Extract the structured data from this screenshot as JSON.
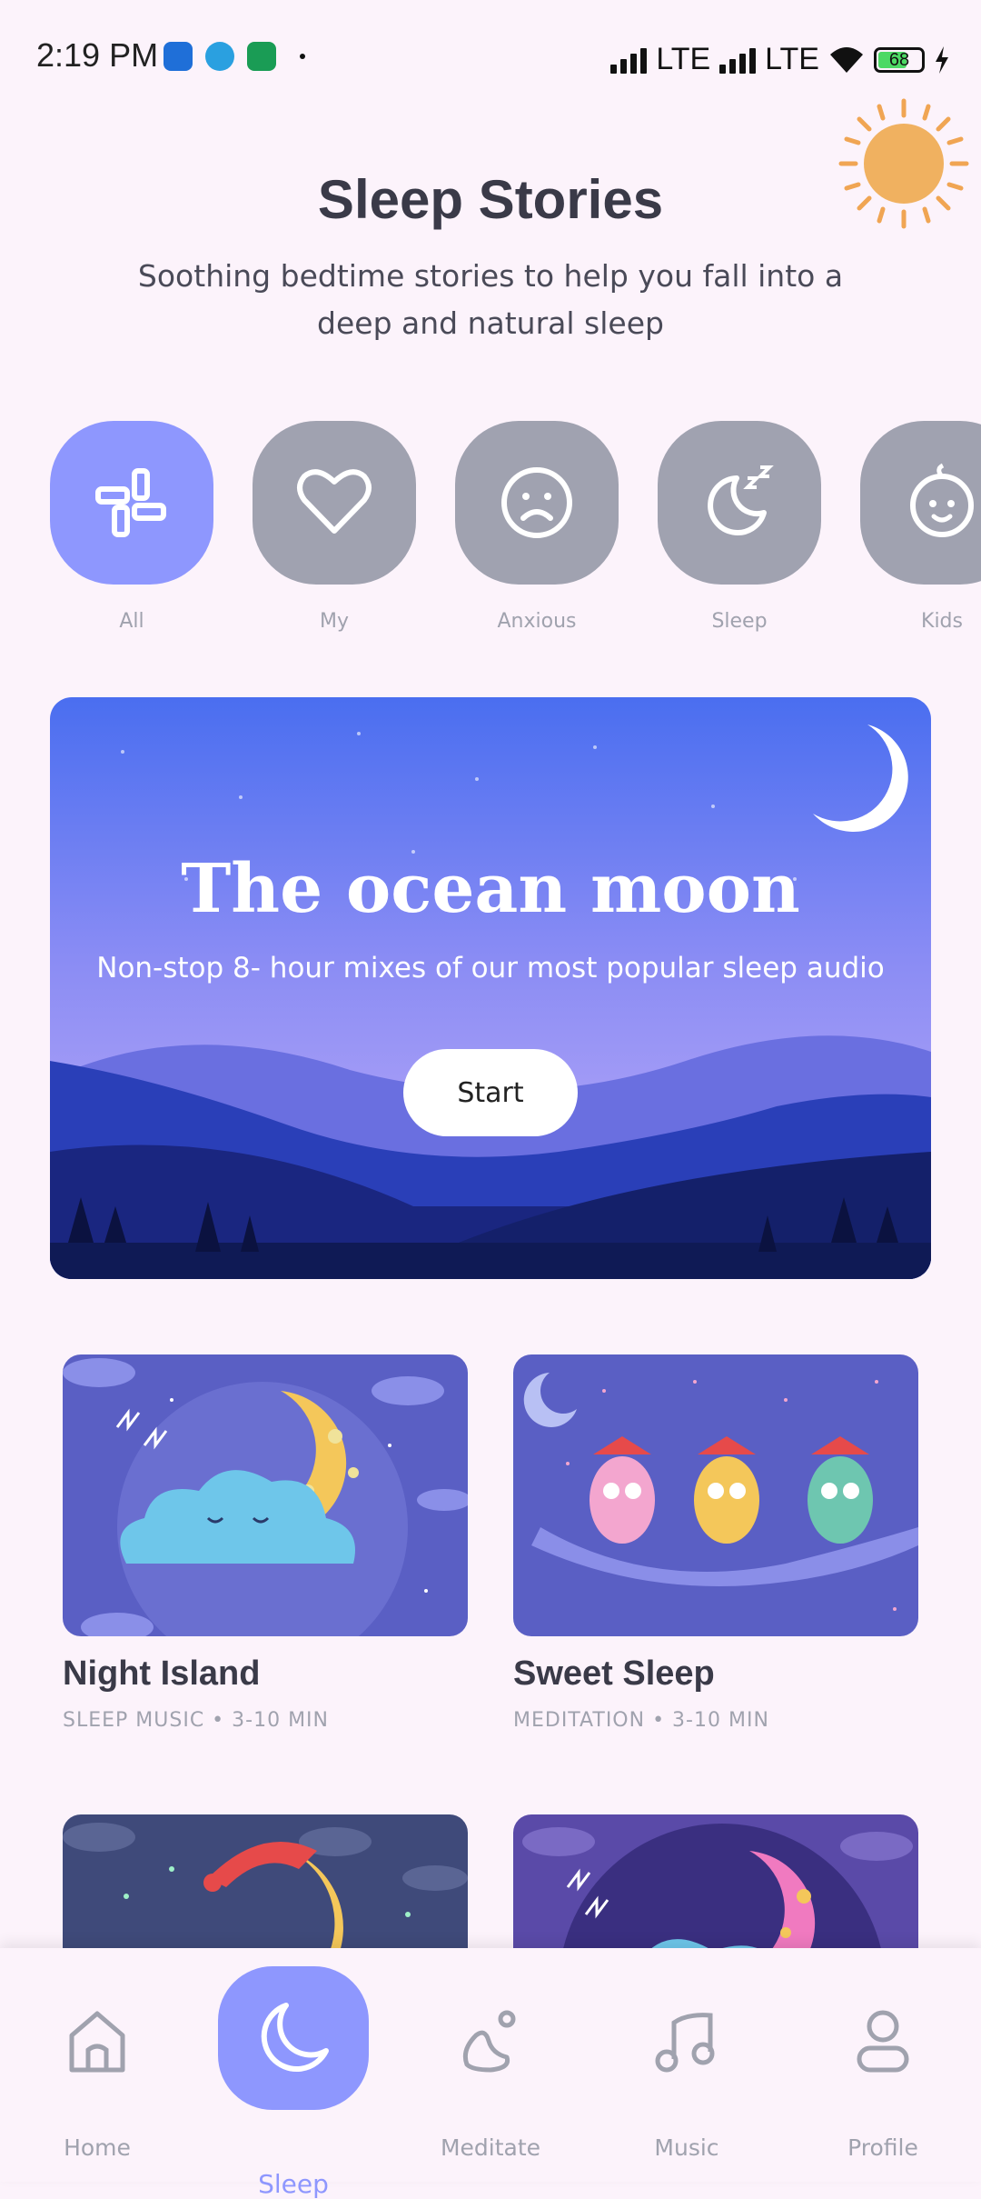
{
  "status": {
    "time": "2:19 PM",
    "network1": "LTE",
    "network2": "LTE",
    "battery": "68"
  },
  "page": {
    "title": "Sleep Stories",
    "subtitle": "Soothing bedtime stories to help you fall into a deep and natural sleep"
  },
  "categories": [
    {
      "label": "All",
      "icon": "grid-icon",
      "active": true
    },
    {
      "label": "My",
      "icon": "heart-icon"
    },
    {
      "label": "Anxious",
      "icon": "sad-face-icon"
    },
    {
      "label": "Sleep",
      "icon": "moon-zzz-icon"
    },
    {
      "label": "Kids",
      "icon": "baby-face-icon"
    }
  ],
  "featured": {
    "title": "The ocean moon",
    "subtitle": "Non-stop 8- hour mixes of our most popular sleep audio",
    "button": "Start"
  },
  "cards": [
    {
      "title": "Night Island",
      "meta": "SLEEP MUSIC • 3-10 MIN"
    },
    {
      "title": "Sweet Sleep",
      "meta": "MEDITATION • 3-10 MIN"
    }
  ],
  "tabs": [
    {
      "label": "Home",
      "icon": "home-icon"
    },
    {
      "label": "Sleep",
      "icon": "moon-icon",
      "active": true
    },
    {
      "label": "Meditate",
      "icon": "meditate-icon"
    },
    {
      "label": "Music",
      "icon": "music-note-icon"
    },
    {
      "label": "Profile",
      "icon": "user-icon"
    }
  ],
  "colors": {
    "accent": "#8e97fe",
    "inactive": "#a0a2b0",
    "background": "#fcf3fb"
  }
}
